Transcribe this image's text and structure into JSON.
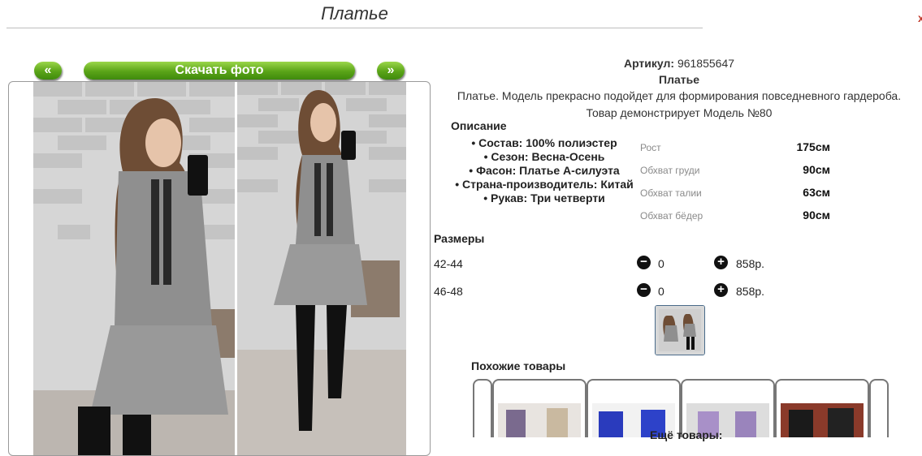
{
  "page": {
    "title": "Платье",
    "close_mark": "x"
  },
  "gallery": {
    "prev_label": "«",
    "download_label": "Скачать фото",
    "next_label": "»"
  },
  "product": {
    "article_label": "Артикул:",
    "article_value": "961855647",
    "name": "Платье",
    "description": "Платье. Модель прекрасно подойдет для формирования повседневного гардероба.",
    "model_note": "Товар демонстрирует Модель №80",
    "description_title": "Описание",
    "features": [
      "Состав: 100% полиэстер",
      "Сезон: Весна-Осень",
      "Фасон: Платье А-силуэта",
      "Страна-производитель: Китай",
      "Рукав: Три четверти"
    ],
    "measurements": [
      {
        "label": "Рост",
        "value": "175см"
      },
      {
        "label": "Обхват груди",
        "value": "90см"
      },
      {
        "label": "Обхват талии",
        "value": "63см"
      },
      {
        "label": "Обхват бёдер",
        "value": "90см"
      }
    ]
  },
  "sizes": {
    "title": "Размеры",
    "minus_symbol": "−",
    "plus_symbol": "+",
    "rows": [
      {
        "size": "42-44",
        "qty": "0",
        "price": "858р."
      },
      {
        "size": "46-48",
        "qty": "0",
        "price": "858р."
      }
    ]
  },
  "similar": {
    "title": "Похожие товары",
    "more": "Ещё товары:"
  },
  "colors": {
    "green_button": "#5aa418",
    "thumb_border": "#4a6b8a"
  }
}
